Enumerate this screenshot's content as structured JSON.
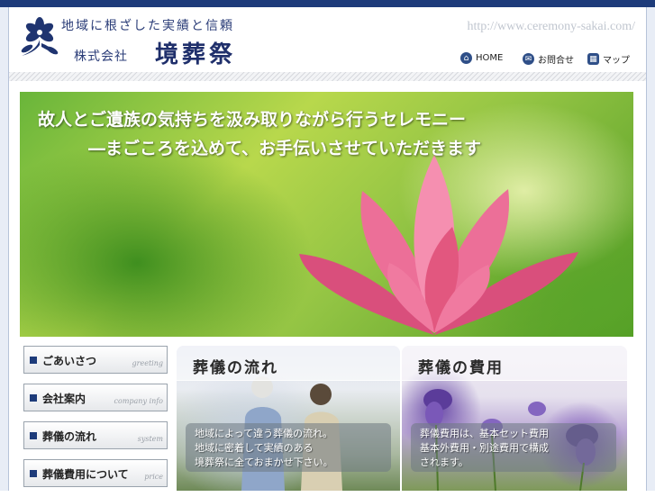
{
  "header": {
    "tagline": "地域に根ざした実績と信頼",
    "corp_prefix": "株式会社",
    "company_name": "境葬祭",
    "url": "http://www.ceremony-sakai.com/"
  },
  "nav": [
    {
      "label": "HOME",
      "icon": "home-icon"
    },
    {
      "label": "お問合せ",
      "icon": "mail-icon"
    },
    {
      "label": "マップ",
      "icon": "map-icon"
    }
  ],
  "hero": {
    "line1": "故人とご遺族の気持ちを汲み取りながら行うセレモニー",
    "line2": "―まごころを込めて、お手伝いさせていただきます"
  },
  "sidebar": [
    {
      "label": "ごあいさつ",
      "en": "greeting"
    },
    {
      "label": "会社案内",
      "en": "company info"
    },
    {
      "label": "葬儀の流れ",
      "en": "system"
    },
    {
      "label": "葬儀費用について",
      "en": "price"
    }
  ],
  "panels": {
    "flow": {
      "title": "葬儀の流れ",
      "text1": "地域によって違う葬儀の流れ。",
      "text2": "地域に密着して実績のある",
      "text3": "境葬祭に全ておまかせ下さい。"
    },
    "cost": {
      "title": "葬儀の費用",
      "text1": "葬儀費用は、基本セット費用",
      "text2": "基本外費用・別途費用で構成",
      "text3": "されます。"
    }
  },
  "colors": {
    "brand": "#1d3b7a",
    "accent": "#2b3d78"
  }
}
